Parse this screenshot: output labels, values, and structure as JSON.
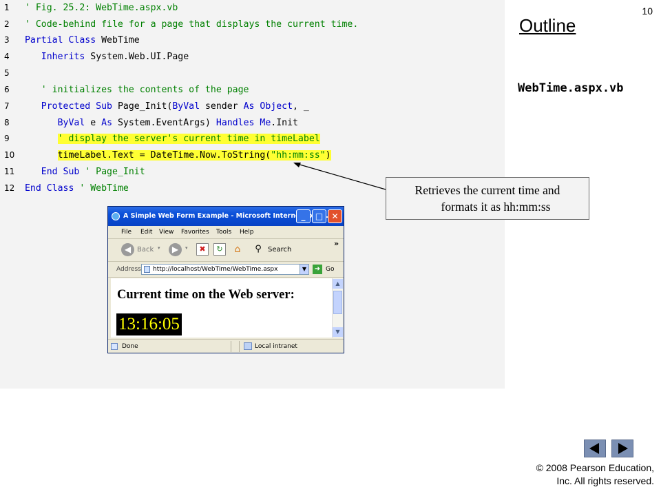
{
  "slide_number": "10",
  "outline_title": "Outline",
  "file_label": "WebTime.aspx.vb",
  "code": {
    "lines": [
      {
        "num": "1",
        "comment": "' Fig. 25.2: WebTime.aspx.vb"
      },
      {
        "num": "2",
        "comment": "' Code-behind file for a page that displays the current time."
      },
      {
        "num": "3",
        "kw1": "Partial Class",
        "text1": " WebTime"
      },
      {
        "num": "4",
        "indent": "   ",
        "kw1": "Inherits",
        "text1": " System.Web.UI.Page"
      },
      {
        "num": "5"
      },
      {
        "num": "6",
        "indent": "   ",
        "comment": "' initializes the contents of the page"
      },
      {
        "num": "7",
        "indent": "   ",
        "kw1": "Protected Sub",
        "text1": " Page_Init(",
        "kw2": "ByVal",
        "text2": " sender ",
        "kw3": "As Object",
        "text3": ", _"
      },
      {
        "num": "8",
        "indent": "      ",
        "kw1": "ByVal",
        "text1": " e ",
        "kw2": "As",
        "text2": " System.EventArgs) ",
        "kw3": "Handles Me",
        "text3": ".Init"
      },
      {
        "num": "9",
        "indent": "      ",
        "comment": "' display the server's current time in timeLabel"
      },
      {
        "num": "10",
        "indent": "      ",
        "text1": "timeLabel.Text = DateTime.Now.ToString(",
        "string": "\"hh:mm:ss\"",
        "text2": ")"
      },
      {
        "num": "11",
        "indent": "   ",
        "kw1": "End Sub",
        "comment": " ' Page_Init"
      },
      {
        "num": "12",
        "kw1": "End Class",
        "comment": " ' WebTime"
      }
    ]
  },
  "callout": {
    "line1": "Retrieves the current time and",
    "line2": "formats it as hh:mm:ss"
  },
  "browser": {
    "title": "A Simple Web Form Example - Microsoft Internet Expl...",
    "menu": [
      "File",
      "Edit",
      "View",
      "Favorites",
      "Tools",
      "Help"
    ],
    "back_label": "Back",
    "search_label": "Search",
    "address_label": "Address",
    "address_value": "http://localhost/WebTime/WebTime.aspx",
    "go_label": "Go",
    "heading": "Current time on the Web server:",
    "time": "13:16:05",
    "status_left": "Done",
    "status_right": "Local intranet"
  },
  "copyright": {
    "line1": "© 2008 Pearson Education,",
    "line2": "Inc.  All rights reserved."
  }
}
